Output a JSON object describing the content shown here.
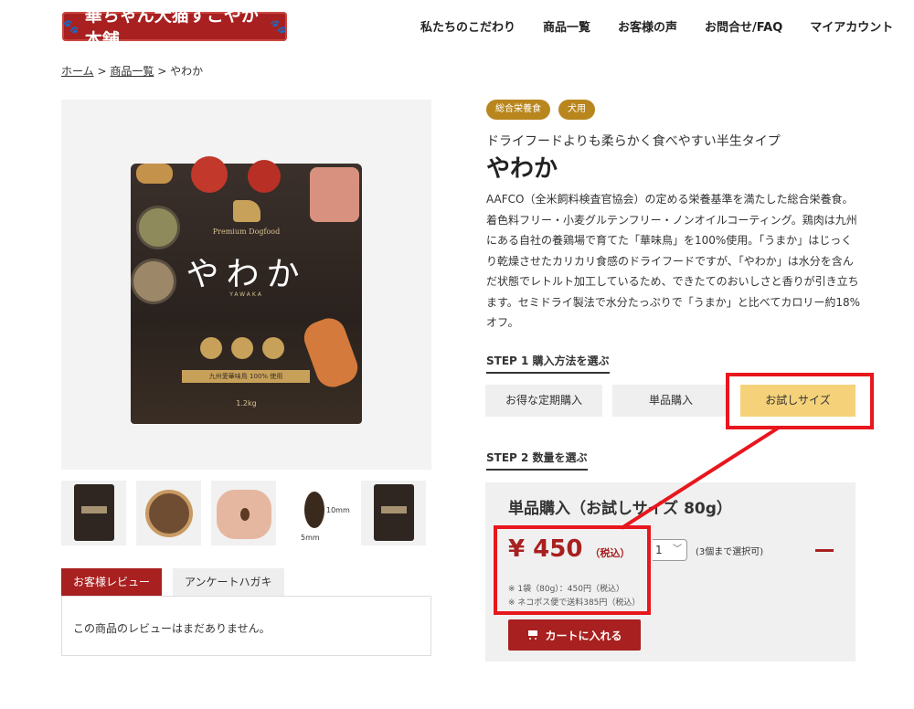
{
  "header": {
    "logo_text": "華ちゃん犬猫すこやか本舗",
    "nav": [
      "私たちのこだわり",
      "商品一覧",
      "お客様の声",
      "お問合せ/FAQ",
      "マイアカウント"
    ]
  },
  "breadcrumb": {
    "home": "ホーム",
    "sep": ">",
    "list": "商品一覧",
    "current": "やわか"
  },
  "package": {
    "brand": "Premium Dogfood",
    "title": "やわか",
    "roman": "YAWAKA",
    "ribbon": "九州愛華味鳥 100% 使用",
    "weight": "1.2kg"
  },
  "thumbnail_dims": {
    "height": "10mm",
    "width": "5mm"
  },
  "tabs": {
    "reviews": "お客様レビュー",
    "survey": "アンケートハガキ"
  },
  "review_empty": "この商品のレビューはまだありません。",
  "product": {
    "badges": [
      "総合栄養食",
      "犬用"
    ],
    "subtitle": "ドライフードよりも柔らかく食べやすい半生タイプ",
    "title": "やわか",
    "description": "AAFCO（全米飼料検査官協会）の定める栄養基準を満たした総合栄養食。着色料フリー・小麦グルテンフリー・ノンオイルコーティング。鶏肉は九州にある自社の養鶏場で育てた「華味鳥」を100%使用。「うまか」はじっくり乾燥させたカリカリ食感のドライフードですが、「やわか」は水分を含んだ状態でレトルト加工しているため、できたてのおいしさと香りが引き立ちます。セミドライ製法で水分たっぷりで「うまか」と比べてカロリー約18%オフ。"
  },
  "step1": {
    "label": "STEP 1 購入方法を選ぶ",
    "options": [
      "お得な定期購入",
      "単品購入",
      "お試しサイズ"
    ],
    "selected": "お試しサイズ"
  },
  "step2": {
    "label": "STEP 2 数量を選ぶ"
  },
  "purchase": {
    "panel_title": "単品購入（お試しサイズ 80g）",
    "price": "¥ 450",
    "tax": "（税込）",
    "note1": "※ 1袋（80g）：450円（税込）",
    "note2": "※ ネコポス便で送料385円（税込）",
    "quantity": "1",
    "quantity_note": "(3個まで選択可)",
    "cart_label": "カートに入れる"
  },
  "colors": {
    "brand_red": "#a8201f",
    "badge_gold": "#b9861e",
    "selected_option": "#f5d27a",
    "highlight": "#e8161d"
  }
}
